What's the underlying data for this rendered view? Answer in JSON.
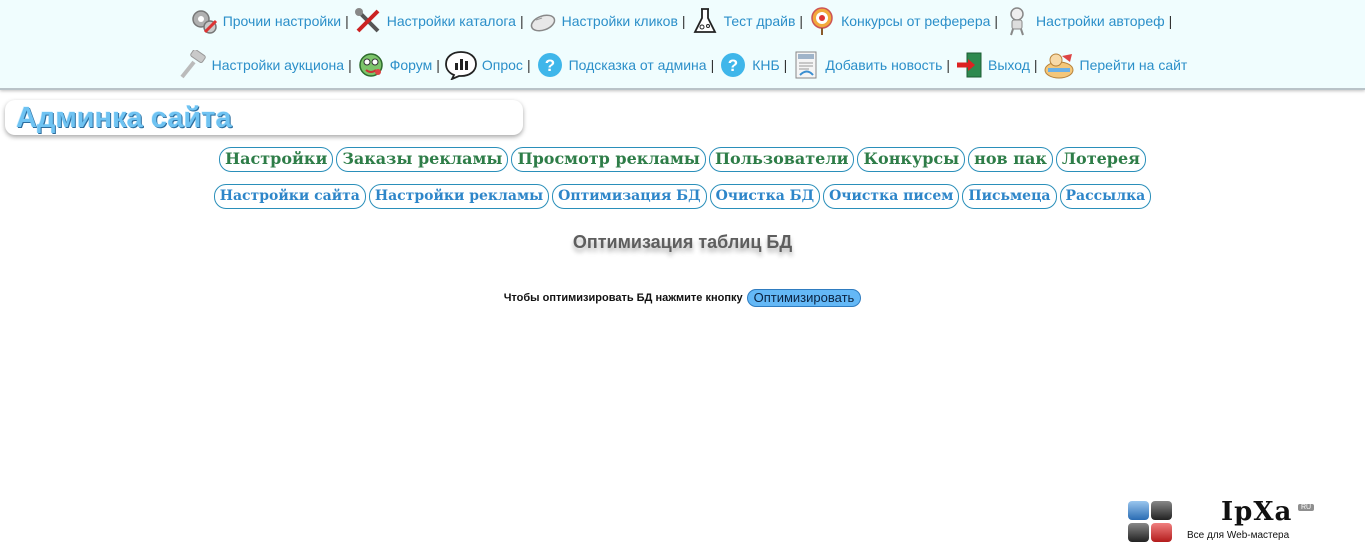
{
  "top_nav": {
    "row1": [
      {
        "label": "Прочии настройки",
        "icon": "gears-icon"
      },
      {
        "label": "Настройки каталога",
        "icon": "tools-icon"
      },
      {
        "label": "Настройки кликов",
        "icon": "mouse-icon"
      },
      {
        "label": "Тест драйв",
        "icon": "flask-icon"
      },
      {
        "label": "Конкурсы от реферера",
        "icon": "target-icon"
      },
      {
        "label": "Настройки автореф",
        "icon": "robot-icon"
      }
    ],
    "row2": [
      {
        "label": "Настройки аукциона",
        "icon": "gavel-icon"
      },
      {
        "label": "Форум",
        "icon": "forum-icon"
      },
      {
        "label": "Опрос",
        "icon": "poll-icon"
      },
      {
        "label": "Подсказка от админа",
        "icon": "help-icon"
      },
      {
        "label": "КНБ",
        "icon": "help-icon"
      },
      {
        "label": "Добавить новость",
        "icon": "news-icon"
      },
      {
        "label": "Выход",
        "icon": "exit-icon"
      },
      {
        "label": "Перейти на сайт",
        "icon": "site-icon"
      }
    ],
    "separator": "|"
  },
  "page_title": "Админка сайта",
  "main_menu": [
    "Настройки",
    "Заказы рекламы",
    "Просмотр рекламы",
    "Пользователи",
    "Конкурсы",
    "нов пак",
    "Лотерея"
  ],
  "sub_menu": [
    "Настройки сайта",
    "Настройки рекламы",
    "Оптимизация БД",
    "Очистка БД",
    "Очистка писем",
    "Письмеца",
    "Рассылка"
  ],
  "section_title": "Оптимизация таблиц БД",
  "optimize": {
    "prompt": "Чтобы оптимизировать БД нажмите кнопку",
    "button": "Оптимизировать"
  },
  "footer_logo": {
    "word": "IpXa",
    "tag": "RU",
    "sub": "Все для Web-мастера"
  },
  "colors": {
    "top_bg": "#f0fdfe",
    "link": "#2b8fc9",
    "main_menu_text": "#2e7d48",
    "sub_menu_text": "#2e86c9",
    "pill_border": "#2a8fba",
    "title": "#6fc3f2",
    "button_bg": "#64b8f6"
  }
}
